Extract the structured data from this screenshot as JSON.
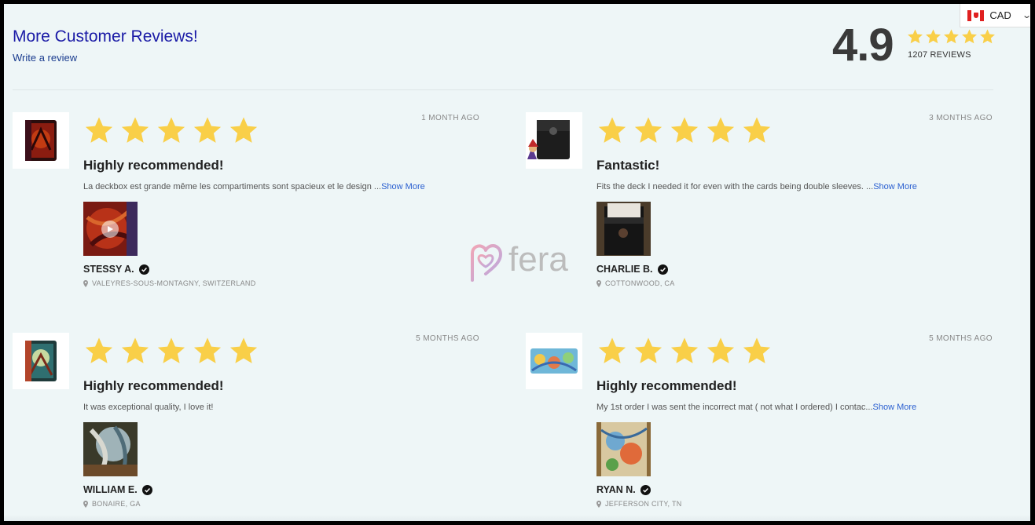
{
  "header": {
    "title": "More Customer Reviews!",
    "write_review": "Write a review",
    "rating": "4.9",
    "review_count": "1207 REVIEWS",
    "star_color": "#f9cf48"
  },
  "currency": {
    "flag_icon": "canada-flag-icon",
    "code": "CAD"
  },
  "reviews": [
    {
      "rating": 5,
      "date": "1 MONTH AGO",
      "title": "Highly recommended!",
      "body": "La deckbox est grande même les compartiments sont spacieux et le design ...",
      "show_more": "Show More",
      "reviewer": "STESSY A.",
      "location": "VALEYRES-SOUS-MONTAGNY, SWITZERLAND",
      "has_video": true
    },
    {
      "rating": 5,
      "date": "3 MONTHS AGO",
      "title": "Fantastic!",
      "body": "Fits the deck I needed it for even with the cards being double sleeves. ...",
      "show_more": "Show More",
      "reviewer": "CHARLIE B.",
      "location": "COTTONWOOD, CA",
      "has_video": false
    },
    {
      "rating": 5,
      "date": "5 MONTHS AGO",
      "title": "Highly recommended!",
      "body": "It was exceptional quality, I love it!",
      "show_more": "",
      "reviewer": "WILLIAM E.",
      "location": "BONAIRE, GA",
      "has_video": false
    },
    {
      "rating": 5,
      "date": "5 MONTHS AGO",
      "title": "Highly recommended!",
      "body": "My 1st order I was sent the incorrect mat ( not what I ordered) I contac...",
      "show_more": "Show More",
      "reviewer": "RYAN N.",
      "location": "JEFFERSON CITY, TN",
      "has_video": false
    }
  ],
  "watermark": {
    "text": "fera"
  }
}
